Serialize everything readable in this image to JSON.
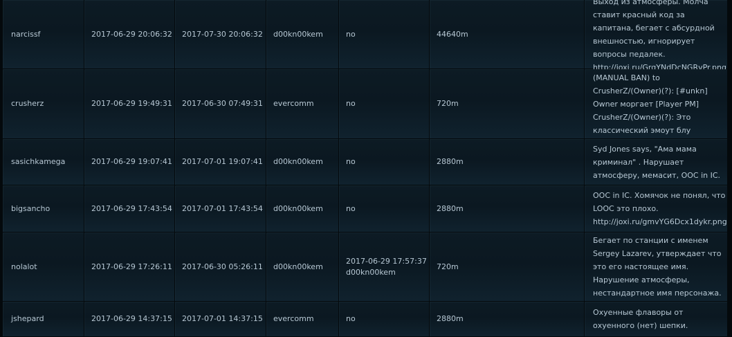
{
  "rows": [
    {
      "ckey": "narcissf",
      "ban_time": "2017-06-29 20:06:32",
      "expires": "2017-07-30 20:06:32",
      "admin": "d00kn00kem",
      "unbanned": "no",
      "duration": "44640m",
      "reason": "Выход из атмосферы. Молча ставит красный код за капитана, бегает с абсурдной внешностью, игнорирует вопросы педалек. http://joxi.ru/GrqYNdDcNGRvPr.png"
    },
    {
      "ckey": "crusherz",
      "ban_time": "2017-06-29 19:49:31",
      "expires": "2017-06-30 07:49:31",
      "admin": "evercomm",
      "unbanned": "no",
      "duration": "720m",
      "reason": "(MANUAL BAN) to CrusherZ/(Owner)(?): [#unkn] Owner моргает [Player PM] CrusherZ/(Owner)(?): Это классический эмоут блу"
    },
    {
      "ckey": "sasichkamega",
      "ban_time": "2017-06-29 19:07:41",
      "expires": "2017-07-01 19:07:41",
      "admin": "d00kn00kem",
      "unbanned": "no",
      "duration": "2880m",
      "reason": "Syd Jones says, \"Ама мама криминал\" . Нарушает атмосферу, мемасит, OOC in IC."
    },
    {
      "ckey": "bigsancho",
      "ban_time": "2017-06-29 17:43:54",
      "expires": "2017-07-01 17:43:54",
      "admin": "d00kn00kem",
      "unbanned": "no",
      "duration": "2880m",
      "reason": "OOC in IC. Хомячок не понял, что LOOC это плохо. http://joxi.ru/gmvYG6Dcx1dykr.png"
    },
    {
      "ckey": "nolalot",
      "ban_time": "2017-06-29 17:26:11",
      "expires": "2017-06-30 05:26:11",
      "admin": "d00kn00kem",
      "unbanned_time": "2017-06-29 17:57:37",
      "unbanned_by": "d00kn00kem",
      "duration": "720m",
      "reason": "Бегает по станции с именем Sergey Lazarev, утверждает что это его настоящее имя. Нарушение атмосферы, нестандартное имя персонажа."
    },
    {
      "ckey": "jshepard",
      "ban_time": "2017-06-29 14:37:15",
      "expires": "2017-07-01 14:37:15",
      "admin": "evercomm",
      "unbanned": "no",
      "duration": "2880m",
      "reason": "Охуенные флаворы от охуенного (нет) шепки."
    }
  ]
}
